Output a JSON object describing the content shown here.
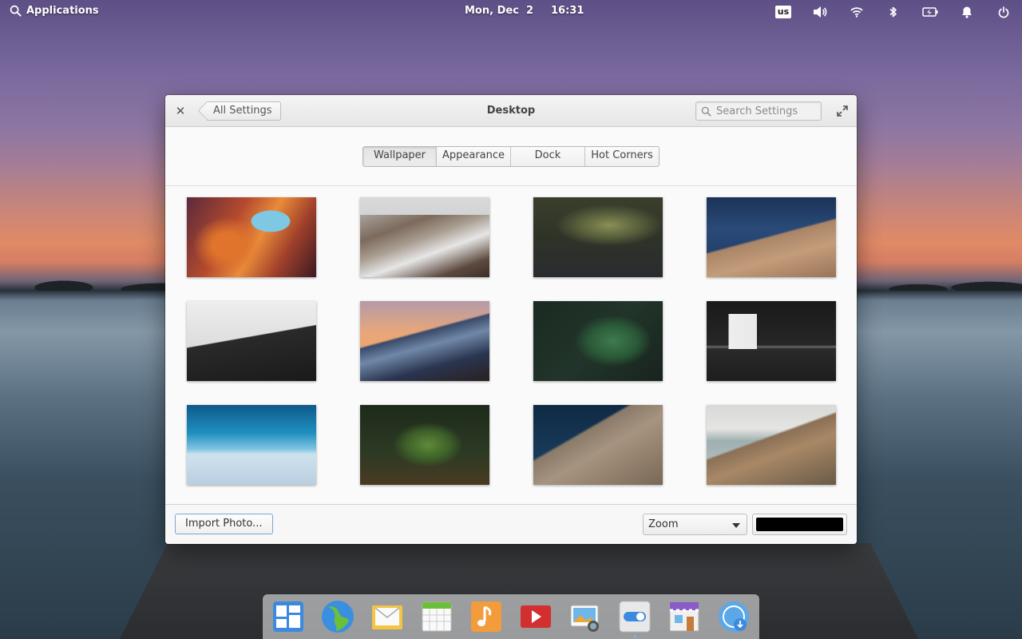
{
  "panel": {
    "applications_label": "Applications",
    "date": "Mon, Dec  2",
    "time": "16:31",
    "keyboard_layout": "us",
    "icons": [
      "volume-icon",
      "wifi-icon",
      "bluetooth-icon",
      "battery-icon",
      "notifications-icon",
      "power-icon"
    ]
  },
  "window": {
    "title": "Desktop",
    "back_label": "All Settings",
    "search_placeholder": "Search Settings",
    "tabs": [
      {
        "label": "Wallpaper",
        "active": true
      },
      {
        "label": "Appearance",
        "active": false
      },
      {
        "label": "Dock",
        "active": false
      },
      {
        "label": "Hot Corners",
        "active": false
      }
    ],
    "wallpapers": [
      "antelope-canyon",
      "snowy-mountain-ridge",
      "misty-forest",
      "water-pier",
      "bird-over-hill",
      "sunset-mountains",
      "fern-leaves",
      "paper-lantern",
      "ocean-wave-aerial",
      "pine-branch",
      "snowy-slope-aerial",
      "coastal-cliff"
    ],
    "footer": {
      "import_label": "Import Photo...",
      "scaling_value": "Zoom",
      "color_value": "#000000"
    }
  },
  "dock": {
    "apps": [
      "multitasking-view",
      "web-browser",
      "mail",
      "calendar",
      "music",
      "videos",
      "photos",
      "system-settings",
      "appcenter",
      "installer"
    ]
  },
  "colors": {
    "accent": "#3689e6",
    "window_bg": "#fafafa"
  }
}
